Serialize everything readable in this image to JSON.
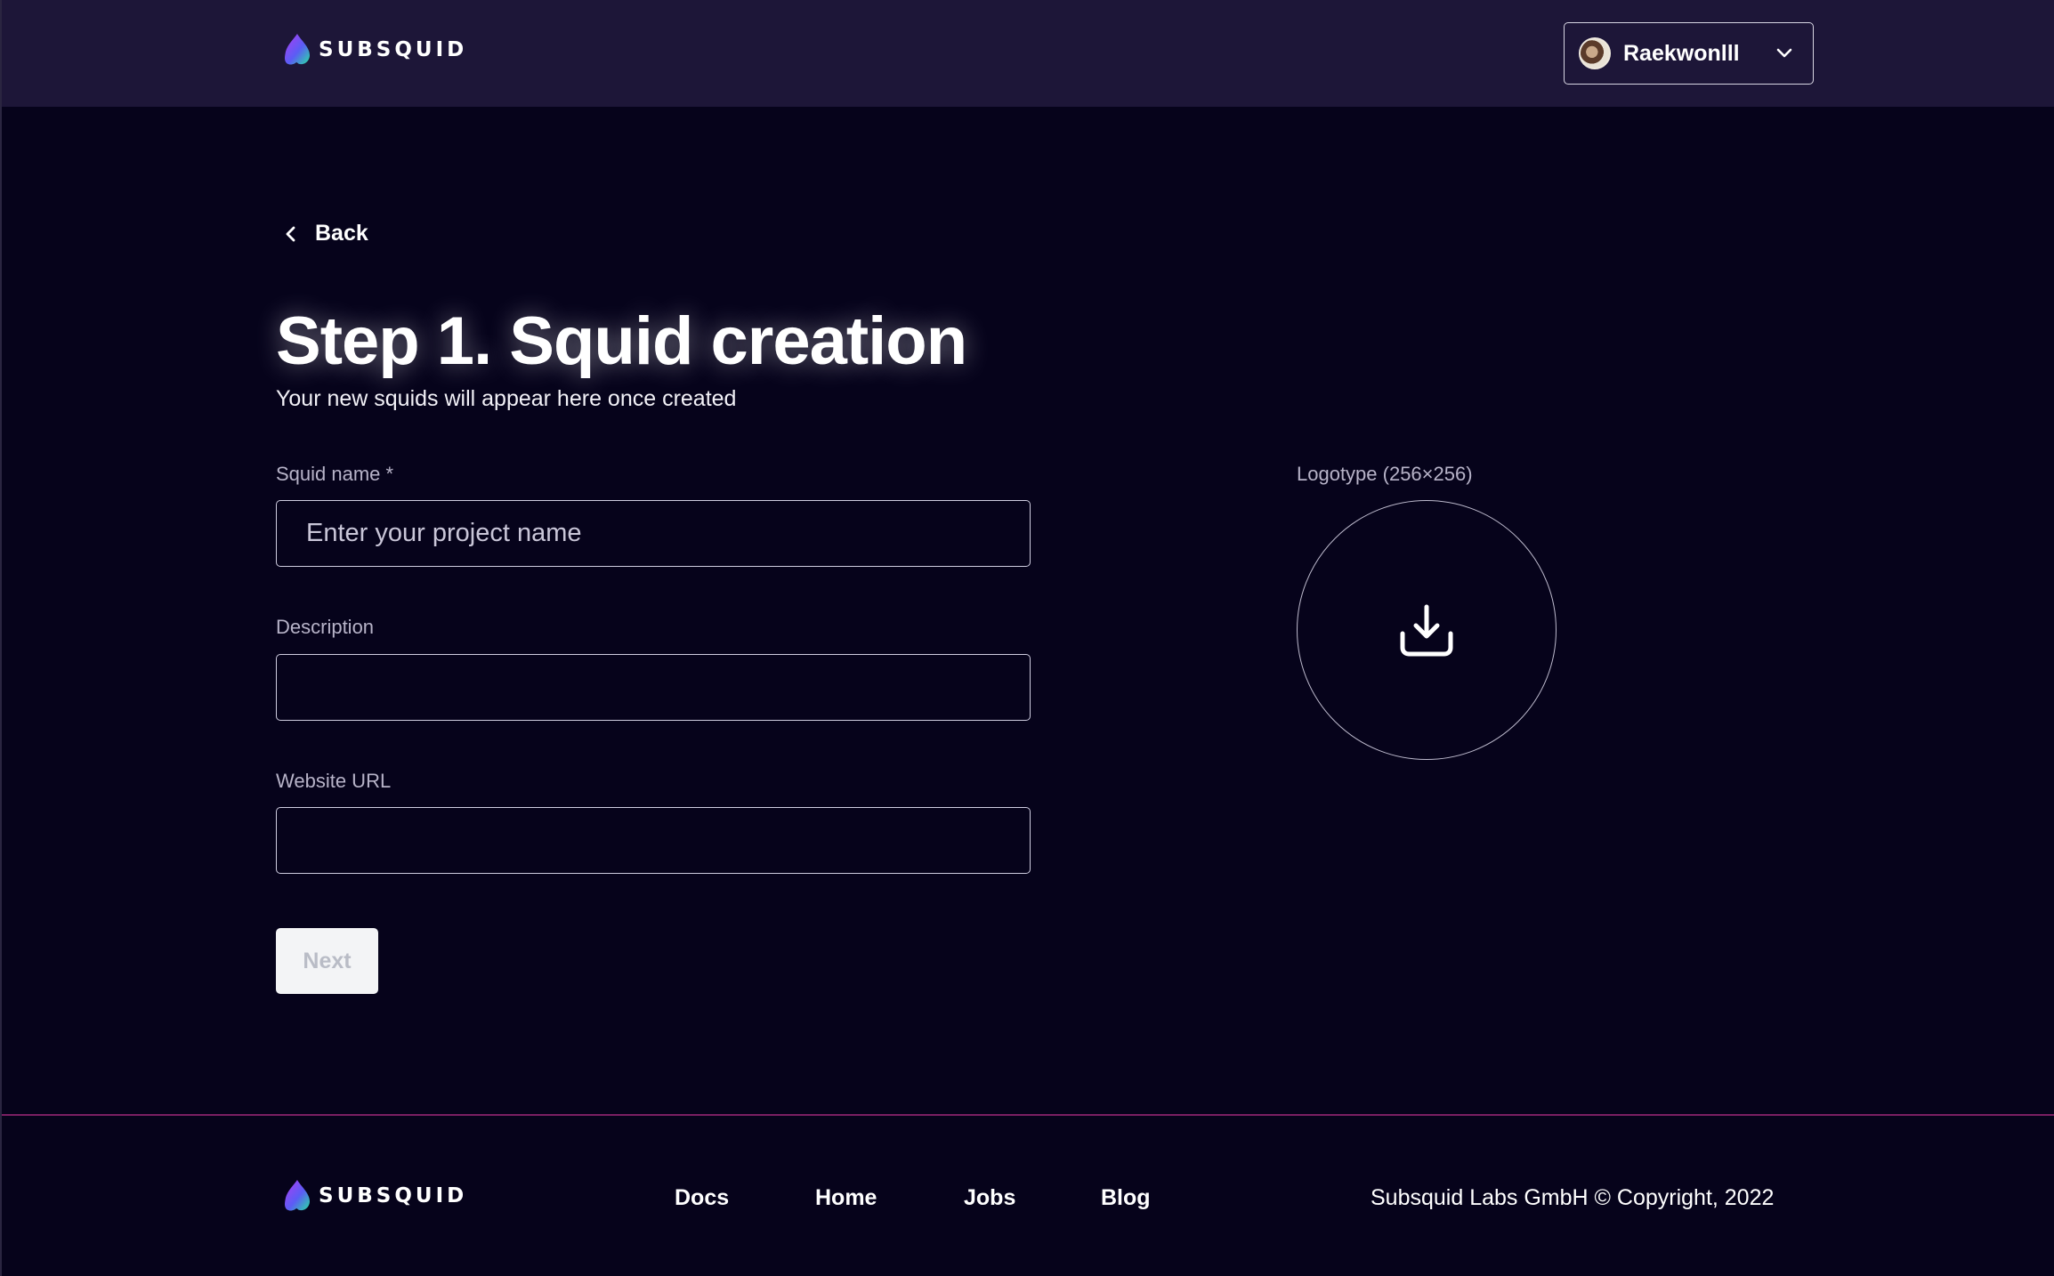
{
  "brand": {
    "name": "SUBSQUID"
  },
  "header": {
    "user": {
      "name": "Raekwonlll"
    }
  },
  "nav": {
    "back_label": "Back"
  },
  "page": {
    "title": "Step 1. Squid creation",
    "subtitle": "Your new squids will appear here once created"
  },
  "form": {
    "squid_name": {
      "label": "Squid name *",
      "placeholder": "Enter your project name",
      "value": ""
    },
    "description": {
      "label": "Description",
      "value": ""
    },
    "website": {
      "label": "Website URL",
      "value": ""
    },
    "next_label": "Next",
    "logotype": {
      "label": "Logotype (256×256)",
      "icon": "download-icon"
    }
  },
  "footer": {
    "links": [
      "Docs",
      "Home",
      "Jobs",
      "Blog"
    ],
    "copyright": "Subsquid Labs GmbH © Copyright, 2022"
  },
  "colors": {
    "background": "#06031b",
    "header": "#1d1638",
    "footer_divider": "#7a1e62",
    "accent_gradient": [
      "#a435f0",
      "#3f7bf5",
      "#2ee59d"
    ]
  }
}
